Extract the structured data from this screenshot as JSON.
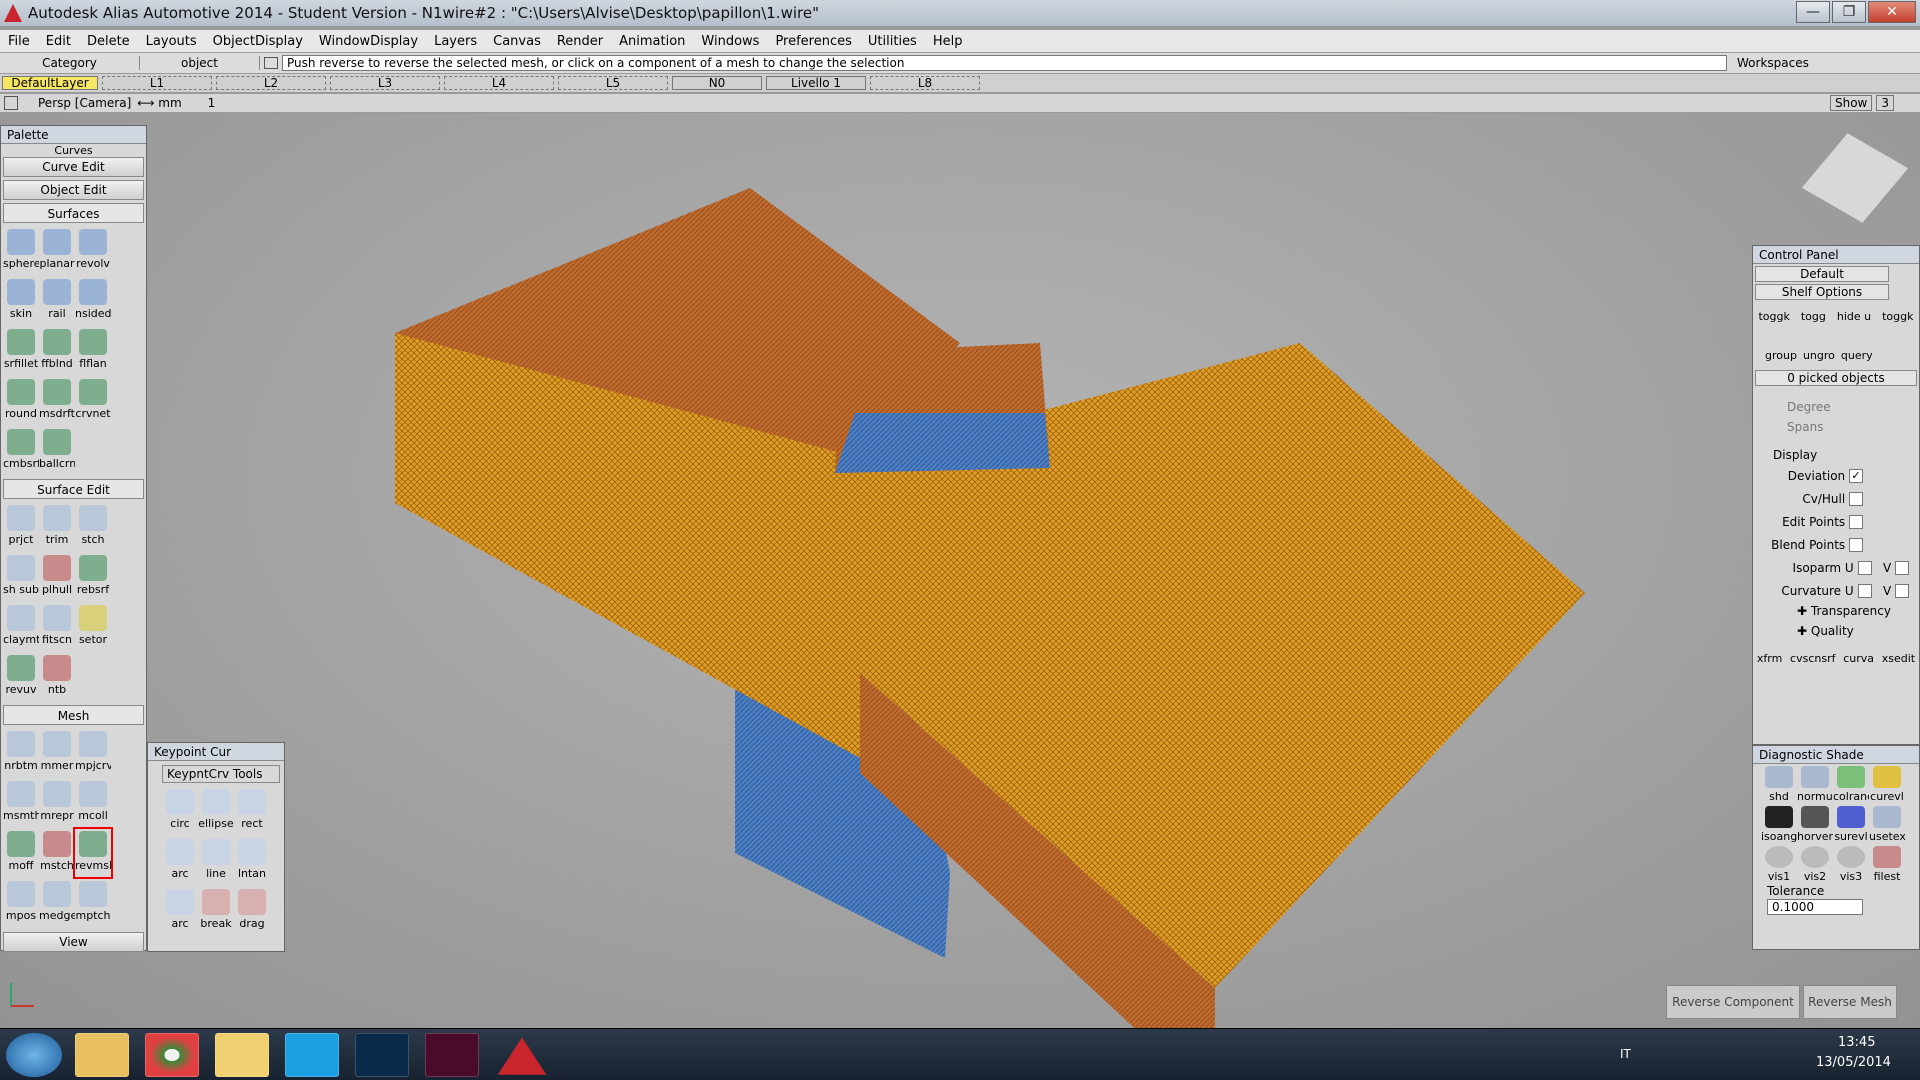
{
  "titlebar": {
    "title": "Autodesk Alias Automotive 2014   - Student Version   - N1wire#2 : \"C:\\Users\\Alvise\\Desktop\\papillon\\1.wire\"",
    "minimize": "—",
    "maximize": "❐",
    "close": "✕"
  },
  "menubar": [
    "File",
    "Edit",
    "Delete",
    "Layouts",
    "ObjectDisplay",
    "WindowDisplay",
    "Layers",
    "Canvas",
    "Render",
    "Animation",
    "Windows",
    "Preferences",
    "Utilities",
    "Help"
  ],
  "prompt": {
    "category": "Category",
    "object": "object",
    "message": "Push reverse to reverse the selected mesh, or click on a component of a mesh to change the selection",
    "workspaces": "Workspaces"
  },
  "layerbar": {
    "default_layer": "DefaultLayer",
    "layers": [
      "L1",
      "L2",
      "L3",
      "L4",
      "L5"
    ],
    "n0": "N0",
    "livello": "Livello 1",
    "l8": "L8"
  },
  "viewbar": {
    "camera": "Persp [Camera]",
    "units": "⟷ mm",
    "zoom": "1",
    "show": "Show",
    "grid_num": "3"
  },
  "palette": {
    "title": "Palette",
    "curves": "Curves",
    "curve_edit": "Curve Edit",
    "object_edit": "Object Edit",
    "surfaces": "Surfaces",
    "surface_tools": [
      "sphere",
      "planar",
      "revolv",
      "skin",
      "rail",
      "nsided",
      "srfillet",
      "ffblnd",
      "flflan",
      "round",
      "msdrft",
      "crvnet",
      "cmbsrf",
      "ballcrn"
    ],
    "surface_edit": "Surface Edit",
    "surface_edit_tools": [
      "prjct",
      "trim",
      "stch",
      "sh sub",
      "plhull",
      "rebsrf",
      "claymt",
      "fitscn",
      "setor",
      "revuv",
      "ntb"
    ],
    "mesh": "Mesh",
    "mesh_tools": [
      "nrbtm",
      "mmer",
      "mpjcrv",
      "msmth",
      "mrepr",
      "mcoll",
      "moff",
      "mstch",
      "revmsh",
      "mpos",
      "medge",
      "mptch"
    ],
    "view": "View"
  },
  "keypoint": {
    "title": "Keypoint Cur",
    "tab": "KeypntCrv Tools",
    "tools": [
      "circ",
      "ellipse",
      "rect",
      "arc",
      "line",
      "lntan",
      "arc",
      "break",
      "drag"
    ]
  },
  "control_panel": {
    "title": "Control Panel",
    "preset": "Default",
    "shelf": "Shelf Options",
    "shelf_tools": [
      "toggk",
      "togg",
      "hide u",
      "toggk"
    ],
    "group_tools": [
      "group",
      "ungro",
      "query"
    ],
    "picked": "0 picked objects",
    "degree": "Degree",
    "spans": "Spans",
    "display": "Display",
    "rows": [
      {
        "label": "Deviation",
        "checked": true
      },
      {
        "label": "Cv/Hull",
        "checked": false
      },
      {
        "label": "Edit Points",
        "checked": false
      },
      {
        "label": "Blend Points",
        "checked": false
      },
      {
        "label": "Isoparm U",
        "checked": false,
        "v": "V"
      },
      {
        "label": "Curvature U",
        "checked": false,
        "v": "V"
      }
    ],
    "transparency": "Transparency",
    "quality": "Quality",
    "eval_tools": [
      "xfrm",
      "cvscnsrf",
      "curva",
      "xsedit"
    ]
  },
  "diagnostic": {
    "title": "Diagnostic Shade",
    "tools": [
      "shd",
      "normul",
      "colranc",
      "curevl",
      "isoang",
      "horver",
      "surevl",
      "usetex",
      "vis1",
      "vis2",
      "vis3",
      "filest"
    ],
    "tolerance_label": "Tolerance",
    "tolerance": "0.1000"
  },
  "bottom": {
    "reverse_component": "Reverse Component",
    "reverse_mesh": "Reverse Mesh"
  },
  "taskbar": {
    "lang": "IT",
    "time": "13:45",
    "date": "13/05/2014"
  }
}
